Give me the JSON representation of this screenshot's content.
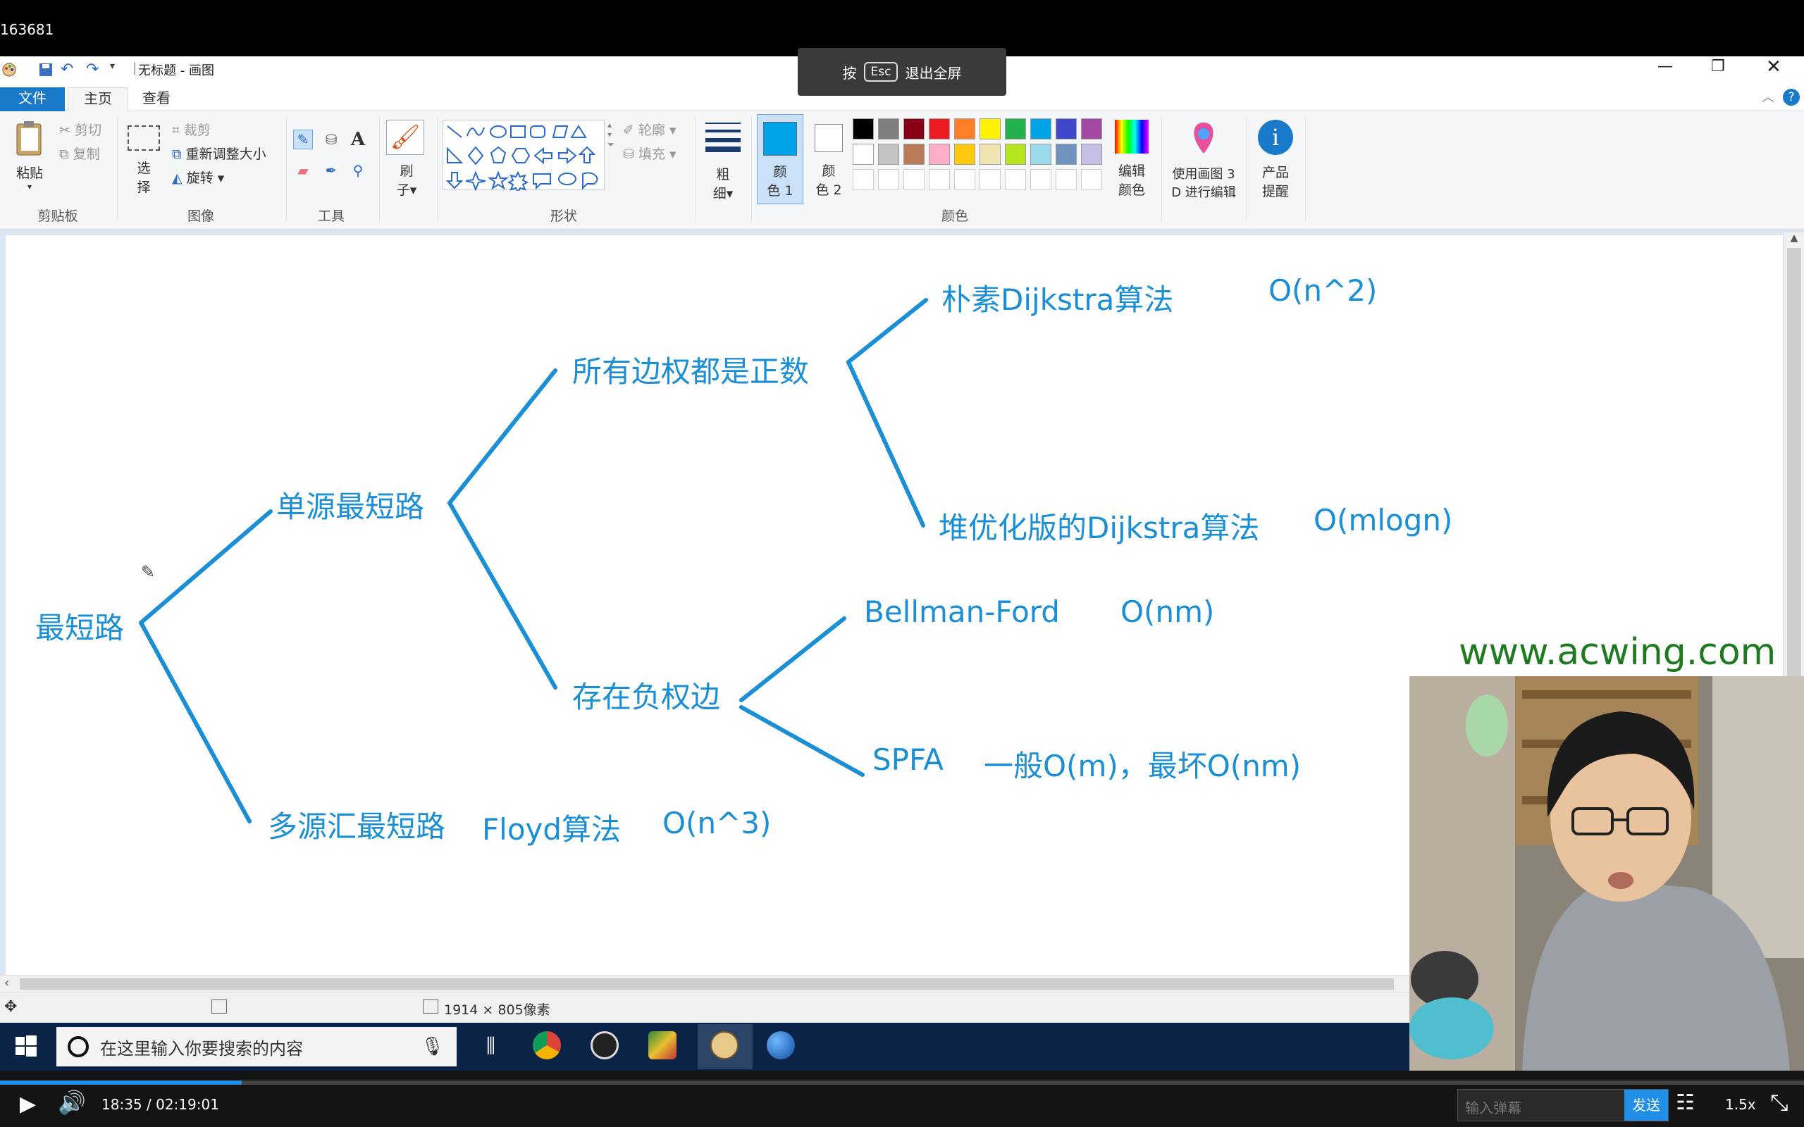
{
  "video_id_fragment": "163681",
  "fullscreen_toast": {
    "press": "按",
    "key": "Esc",
    "action": "退出全屏"
  },
  "window": {
    "title": "无标题 - 画图"
  },
  "tabs": {
    "file": "文件",
    "home": "主页",
    "view": "查看"
  },
  "ribbon": {
    "clipboard": {
      "paste": "粘贴",
      "cut": "剪切",
      "copy": "复制",
      "group": "剪贴板"
    },
    "image": {
      "select1": "选",
      "select2": "择",
      "crop": "裁剪",
      "resize": "重新调整大小",
      "rotate": "旋转",
      "group": "图像"
    },
    "tools": {
      "group": "工具"
    },
    "brushes": {
      "label1": "刷",
      "label2": "子"
    },
    "shapes": {
      "outline": "轮廓",
      "fill": "填充",
      "group": "形状"
    },
    "size": {
      "label1": "粗",
      "label2": "细"
    },
    "color1": {
      "label1": "颜",
      "label2": "色 1"
    },
    "color2": {
      "label1": "颜",
      "label2": "色 2"
    },
    "colors": {
      "group": "颜色",
      "edit1": "编辑",
      "edit2": "颜色"
    },
    "paint3d": {
      "label1": "使用画图 3",
      "label2": "D 进行编辑"
    },
    "alert": {
      "label1": "产品",
      "label2": "提醒"
    }
  },
  "palette": [
    "#000000",
    "#7f7f7f",
    "#880015",
    "#ed1c24",
    "#ff7f27",
    "#fff200",
    "#22b14c",
    "#00a2e8",
    "#3f48cc",
    "#a349a4",
    "#ffffff",
    "#c3c3c3",
    "#b97a57",
    "#ffaec9",
    "#ffc90e",
    "#efe4b0",
    "#b5e61d",
    "#99d9ea",
    "#7092be",
    "#c8bfe7"
  ],
  "accent": "#1a8fd6",
  "diagram": {
    "root": "最短路",
    "single": "单源最短路",
    "positive": "所有边权都是正数",
    "naive": "朴素Dijkstra算法",
    "naive_c": "O(n^2)",
    "heap": "堆优化版的Dijkstra算法",
    "heap_c": "O(mlogn)",
    "negative": "存在负权边",
    "bf": "Bellman-Ford",
    "bf_c": "O(nm)",
    "spfa": "SPFA",
    "spfa_c": "一般O(m)，最坏O(nm)",
    "multi": "多源汇最短路",
    "floyd": "Floyd算法",
    "floyd_c": "O(n^3)"
  },
  "status": {
    "dimensions": "1914 × 805像素"
  },
  "taskbar": {
    "search_placeholder": "在这里输入你要搜索的内容"
  },
  "watermark": "www.acwing.com",
  "player": {
    "time": "18:35 / 02:19:01",
    "progress": 0.134,
    "danmaku_placeholder": "输入弹幕",
    "send": "发送",
    "speed": "1.5x"
  }
}
